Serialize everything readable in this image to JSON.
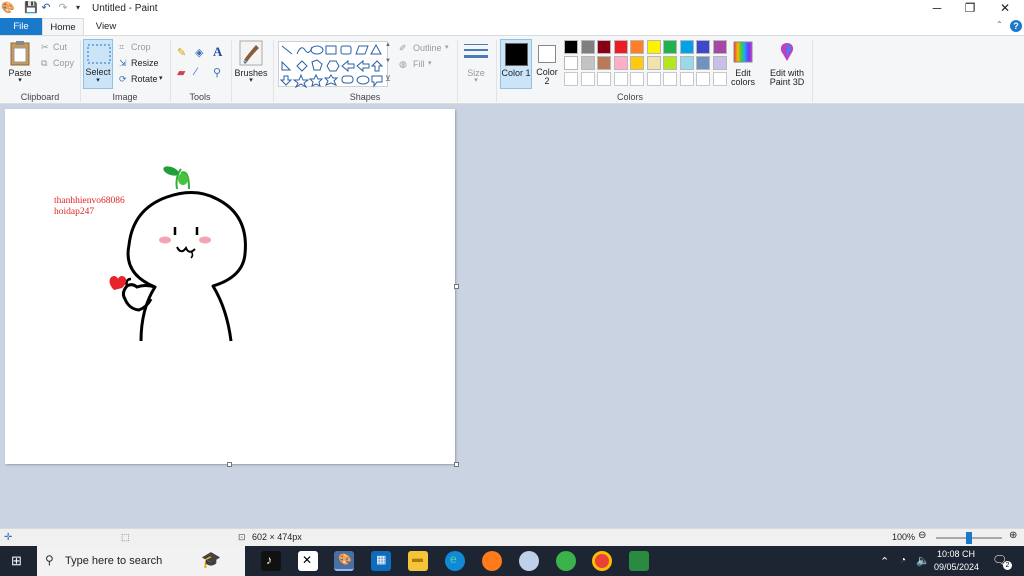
{
  "window": {
    "title": "Untitled - Paint",
    "min_glyph": "─",
    "max_glyph": "❐",
    "close_glyph": "✕"
  },
  "tabs": {
    "file": "File",
    "home": "Home",
    "view": "View"
  },
  "clipboard": {
    "paste": "Paste",
    "cut": "Cut",
    "copy": "Copy",
    "group": "Clipboard"
  },
  "image": {
    "select": "Select",
    "crop": "Crop",
    "resize": "Resize",
    "rotate": "Rotate",
    "group": "Image"
  },
  "tools": {
    "group": "Tools"
  },
  "brushes": {
    "label": "Brushes"
  },
  "shapes": {
    "outline": "Outline",
    "fill": "Fill",
    "group": "Shapes"
  },
  "size": {
    "label": "Size"
  },
  "colors": {
    "color1": "Color 1",
    "color2": "Color 2",
    "edit_colors": "Edit colors",
    "edit_paint3d": "Edit with Paint 3D",
    "group": "Colors",
    "color1_value": "#000000",
    "color2_value": "#ffffff",
    "palette_row1": [
      "#000000",
      "#7f7f7f",
      "#880015",
      "#ed1c24",
      "#ff7f27",
      "#fff200",
      "#22b14c",
      "#00a2e8",
      "#3f48cc",
      "#a349a4"
    ],
    "palette_row2": [
      "#ffffff",
      "#c3c3c3",
      "#b97a57",
      "#ffaec9",
      "#ffc90e",
      "#efe4b0",
      "#b5e61d",
      "#99d9ea",
      "#7092be",
      "#c8bfe7"
    ]
  },
  "canvas": {
    "text_line1": "thanhhienvo68086",
    "text_line2": "hoidap247"
  },
  "status": {
    "size": "602 × 474px",
    "zoom": "100%"
  },
  "taskbar": {
    "search_placeholder": "Type here to search",
    "time": "10:08 CH",
    "date": "09/05/2024"
  }
}
